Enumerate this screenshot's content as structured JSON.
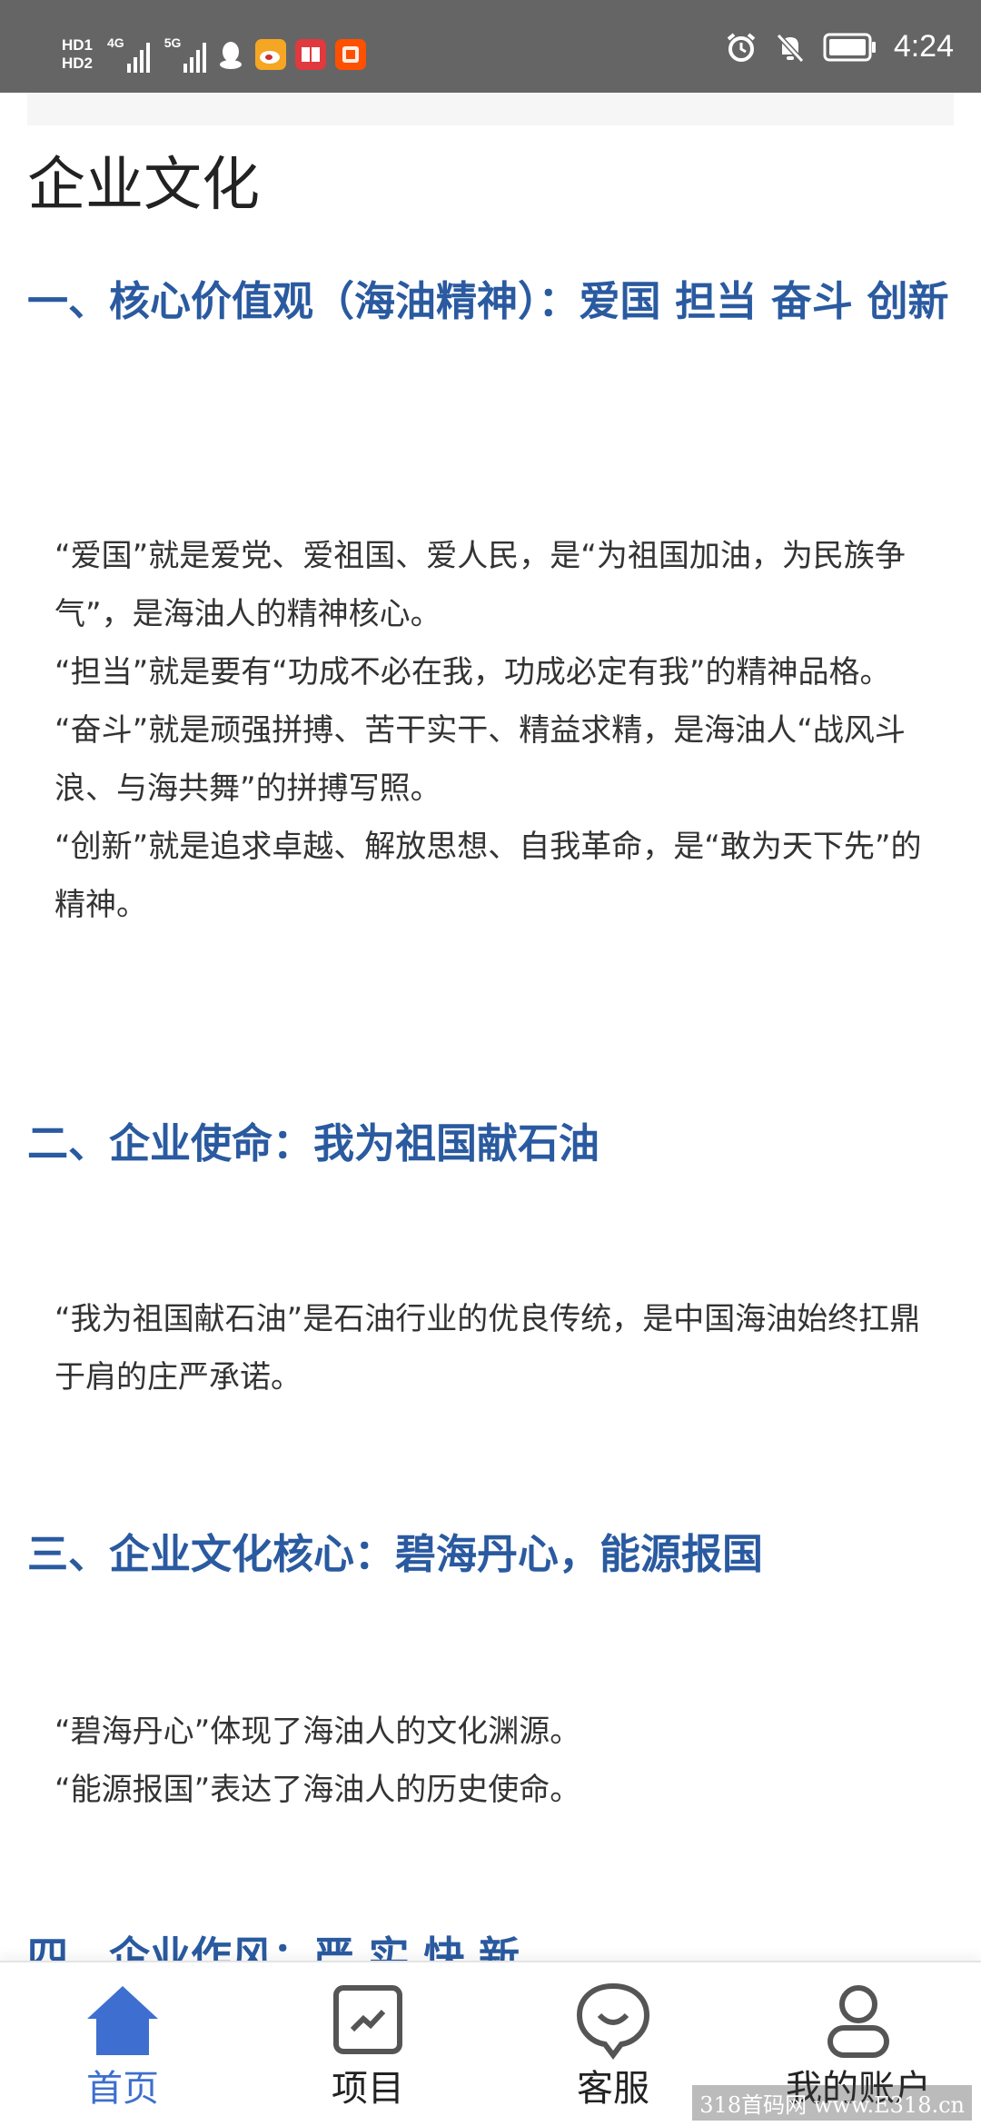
{
  "status_bar": {
    "hd1": "HD1",
    "hd2": "HD2",
    "net1": "4G",
    "net2": "5G",
    "time": "4:24"
  },
  "page": {
    "title": "企业文化"
  },
  "sections": [
    {
      "heading": "一、核心价值观（海油精神）：爱国 担当 奋斗 创新",
      "lines": [
        "“爱国”就是爱党、爱祖国、爱人民，是“为祖国加油，为民族争气”，是海油人的精神核心。",
        "“担当”就是要有“功成不必在我，功成必定有我”的精神品格。",
        "“奋斗”就是顽强拼搏、苦干实干、精益求精，是海油人“战风斗浪、与海共舞”的拼搏写照。",
        "“创新”就是追求卓越、解放思想、自我革命，是“敢为天下先”的精神。"
      ]
    },
    {
      "heading": "二、企业使命：我为祖国献石油",
      "lines": [
        "“我为祖国献石油”是石油行业的优良传统，是中国海油始终扛鼎于肩的庄严承诺。"
      ]
    },
    {
      "heading": "三、企业文化核心：碧海丹心，能源报国",
      "lines": [
        "“碧海丹心”体现了海油人的文化渊源。",
        "“能源报国”表达了海油人的历史使命。"
      ]
    },
    {
      "heading": "四、企业作风：严 实 快 新",
      "lines": []
    }
  ],
  "bottom_nav": {
    "items": [
      {
        "label": "首页",
        "icon": "home-icon",
        "active": true
      },
      {
        "label": "项目",
        "icon": "chart-icon",
        "active": false
      },
      {
        "label": "客服",
        "icon": "chat-icon",
        "active": false
      },
      {
        "label": "我的账户",
        "icon": "user-icon",
        "active": false
      }
    ],
    "active_color": "#3e6fd0",
    "inactive_color": "#555555"
  },
  "watermark": "318首码网 www.E318.cn",
  "colors": {
    "heading": "#2a5aa0",
    "status_bar": "#656565",
    "app_qq": "#ffffff",
    "app_weibo": "#f5a623",
    "app_book": "#e0393e",
    "app_taobao": "#ff5000"
  }
}
